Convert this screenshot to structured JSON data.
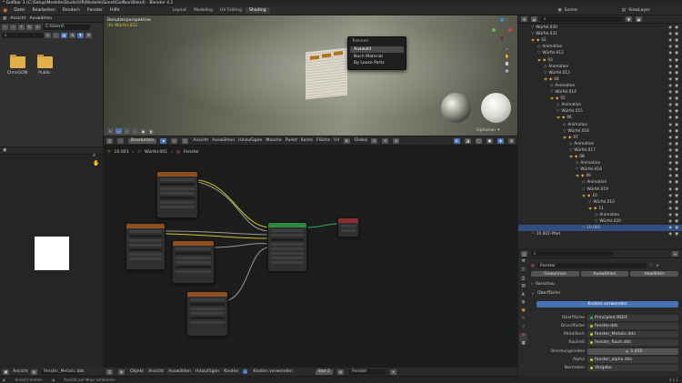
{
  "window": {
    "title": "* Golfbar 3 (C:\\Setup\\Modelle\\Studio\\VR\\Modelle\\Sonst\\Golfbar\\Blend) - Blender 4.1"
  },
  "menu": [
    "Datei",
    "Bearbeiten",
    "Rendern",
    "Fenster",
    "Hilfe"
  ],
  "workspaces": [
    "Layout",
    "Modeling",
    "UV Editing",
    "Shading"
  ],
  "active_workspace": "Shading",
  "scene": {
    "label": "Scene",
    "view_layer": "ViewLayer"
  },
  "filebrowser": {
    "menus": [
      "Ansicht",
      "Auswählen"
    ],
    "path": "C:\\Users\\",
    "folders": [
      {
        "name": "ChrisGON"
      },
      {
        "name": "Public"
      }
    ]
  },
  "viewport": {
    "overlay_line1": "Benutzerperspektive",
    "overlay_line2": "(0) Würfel.022",
    "context_menu": {
      "title": "Trennen",
      "items": [
        "Auswahl",
        "Nach Material",
        "By Loose Parts"
      ]
    },
    "header_items": [
      "Bearbeiten",
      "Ansicht",
      "Auswählen",
      "Hinzufügen",
      "Masche",
      "Punkt",
      "Kante",
      "Fläche",
      "UV"
    ],
    "orientation": "Global",
    "options": "Optionen"
  },
  "node_editor": {
    "breadcrumb": [
      "10.001",
      "Würfel.001",
      "Fenster"
    ],
    "footer_menus": [
      "Objekt",
      "Ansicht",
      "Auswählen",
      "Hinzufügen",
      "Knoten"
    ],
    "use_nodes_label": "Knoten verwenden",
    "slot": "Slot 2",
    "material": "Fenster"
  },
  "image_editor": {
    "menu": "Ansicht",
    "image": "fenster_Metalic.dds"
  },
  "outliner": {
    "search_placeholder": "",
    "rows": [
      {
        "indent": 0,
        "name": "Würfel.030",
        "type": "mesh"
      },
      {
        "indent": 0,
        "name": "Würfel.031",
        "type": "mesh"
      },
      {
        "indent": 0,
        "name": "02",
        "type": "empty"
      },
      {
        "indent": 1,
        "name": "Animation",
        "type": "anim"
      },
      {
        "indent": 1,
        "name": "Würfel.012",
        "type": "mesh"
      },
      {
        "indent": 1,
        "name": "03",
        "type": "empty"
      },
      {
        "indent": 2,
        "name": "Animation",
        "type": "anim"
      },
      {
        "indent": 2,
        "name": "Würfel.013",
        "type": "mesh"
      },
      {
        "indent": 2,
        "name": "04",
        "type": "empty"
      },
      {
        "indent": 3,
        "name": "Animation",
        "type": "anim"
      },
      {
        "indent": 3,
        "name": "Würfel.014",
        "type": "mesh"
      },
      {
        "indent": 3,
        "name": "05",
        "type": "empty"
      },
      {
        "indent": 4,
        "name": "Animation",
        "type": "anim"
      },
      {
        "indent": 4,
        "name": "Würfel.015",
        "type": "mesh"
      },
      {
        "indent": 4,
        "name": "06",
        "type": "empty"
      },
      {
        "indent": 5,
        "name": "Animation",
        "type": "anim"
      },
      {
        "indent": 5,
        "name": "Würfel.016",
        "type": "mesh"
      },
      {
        "indent": 5,
        "name": "07",
        "type": "empty"
      },
      {
        "indent": 6,
        "name": "Animation",
        "type": "anim"
      },
      {
        "indent": 6,
        "name": "Würfel.017",
        "type": "mesh"
      },
      {
        "indent": 6,
        "name": "08",
        "type": "empty"
      },
      {
        "indent": 7,
        "name": "Animation",
        "type": "anim"
      },
      {
        "indent": 7,
        "name": "Würfel.018",
        "type": "mesh"
      },
      {
        "indent": 7,
        "name": "09",
        "type": "empty"
      },
      {
        "indent": 8,
        "name": "Animation",
        "type": "anim"
      },
      {
        "indent": 8,
        "name": "Würfel.019",
        "type": "mesh"
      },
      {
        "indent": 8,
        "name": "10",
        "type": "empty"
      },
      {
        "indent": 9,
        "name": "Würfel.010",
        "type": "mesh"
      },
      {
        "indent": 9,
        "name": "11",
        "type": "empty"
      },
      {
        "indent": 10,
        "name": "Animation",
        "type": "anim"
      },
      {
        "indent": 10,
        "name": "Würfel.020",
        "type": "mesh"
      },
      {
        "indent": 8,
        "name": "10.001",
        "type": "mesh",
        "selected": true
      },
      {
        "indent": 0,
        "name": "10.001-Pfad",
        "type": "curve"
      }
    ]
  },
  "properties": {
    "tabs": [
      "Oberfläche",
      "Volumen",
      "Anzeige"
    ],
    "tabs_top": [
      "Gewonnen",
      "Auswählen",
      "Abwählen"
    ],
    "sections": [
      "Vorschau",
      "Oberfläche"
    ],
    "use_nodes_button": "Knoten verwenden",
    "rows": [
      {
        "label": "Oberfläche",
        "value": "Principled BSDF"
      },
      {
        "label": "Grundfarbe",
        "value": "fenster.dds"
      },
      {
        "label": "Metallisch",
        "value": "fenster_Metalic.dds"
      },
      {
        "label": "Rauheit",
        "value": "fenster_Rauh.dds"
      },
      {
        "label": "Brechungsindex",
        "value": "1.450"
      },
      {
        "label": "Alpha",
        "value": "fenster_alpha.dds"
      },
      {
        "label": "Normalen",
        "value": "Vorgabe"
      }
    ],
    "material_field": "Fenster"
  },
  "statusbar": {
    "left": "Ansicht drehen",
    "middle": "Ansicht auf Maus zentrieren",
    "version": "4.1.1"
  },
  "colors": {
    "accent": "#4772b3",
    "folder": "#e2b04a",
    "node_texture": "#8f4e1e",
    "node_shader": "#2d8a3a"
  }
}
